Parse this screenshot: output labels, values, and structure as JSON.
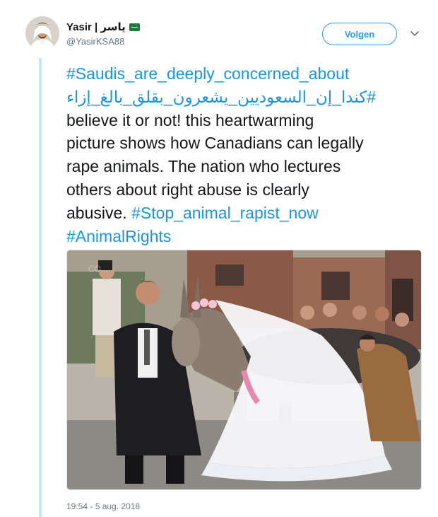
{
  "user": {
    "display_name": "Yasir | ياسر",
    "flag_icon": "saudi-flag-icon",
    "handle": "@YasirKSA88",
    "avatar_icon": "user-avatar"
  },
  "actions": {
    "follow_label": "Volgen",
    "more_icon": "chevron-down-icon"
  },
  "tweet": {
    "hashtag_1": "#Saudis_are_deeply_concerned_about",
    "hashtag_2": "#كندا_إن_السعوديين_يشعرون_بقلق_بالغ_إزاء",
    "line_3": "believe it or not! this heartwarming",
    "line_4": "picture shows how Canadians can legally",
    "line_5": "rape animals. The nation who lectures",
    "line_6": "others about right abuse is clearly",
    "line_7_text": "abusive. ",
    "hashtag_3": "#Stop_animal_rapist_now",
    "hashtag_4": "#AnimalRights"
  },
  "media": {
    "type": "photo",
    "watermark": "CO..."
  },
  "timestamp": "19:54 - 5 aug. 2018",
  "colors": {
    "link": "#1b95e0",
    "follow_blue": "#1da1f2",
    "muted": "#657786",
    "thread_line": "#c4e6f8"
  }
}
